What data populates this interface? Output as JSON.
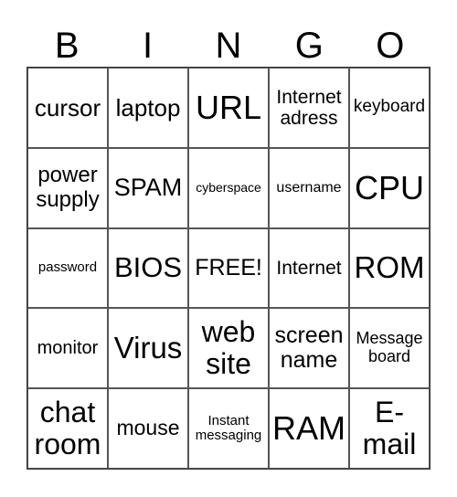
{
  "header": [
    "B",
    "I",
    "N",
    "G",
    "O"
  ],
  "cells": [
    "cursor",
    "laptop",
    "URL",
    "Internet adress",
    "keyboard",
    "power supply",
    "SPAM",
    "cyberspace",
    "username",
    "CPU",
    "password",
    "BIOS",
    "FREE!",
    "Internet",
    "ROM",
    "monitor",
    "Virus",
    "web site",
    "screen name",
    "Message board",
    "chat room",
    "mouse",
    "Instant messaging",
    "RAM",
    "E-mail"
  ]
}
